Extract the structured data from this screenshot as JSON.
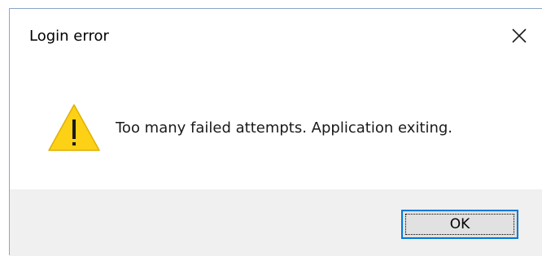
{
  "window": {
    "title": "Login error",
    "close_icon": "close-icon"
  },
  "content": {
    "icon": "warning-icon",
    "message": "Too many failed attempts. Application exiting."
  },
  "footer": {
    "ok_label": "OK"
  },
  "colors": {
    "accent": "#0078d7",
    "footer_bg": "#f0f0f0",
    "warning_fill": "#fcd116"
  }
}
